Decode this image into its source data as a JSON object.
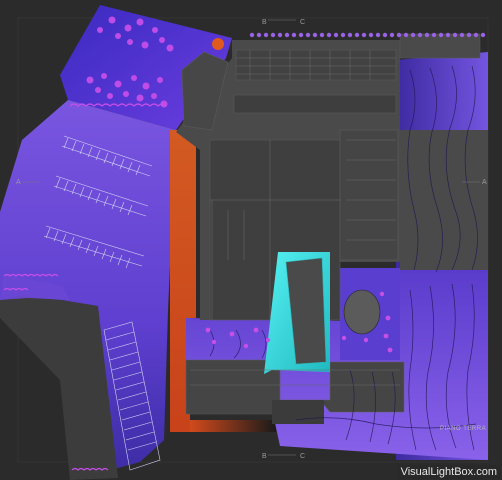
{
  "labels": {
    "section_a_left": "A",
    "section_a_right": "A",
    "section_b_top": "B",
    "section_c_top": "C",
    "section_b_bottom": "B",
    "section_c_bottom": "C"
  },
  "plan_title": "PIANO TERRA",
  "watermark": "VisualLightBox.com",
  "colors": {
    "background": "#2b2b2b",
    "violet": "#6e4bd6",
    "deep_blue": "#3a2aa8",
    "orange": "#d8521e",
    "cyan": "#3fe6e6",
    "magenta_dots": "#c64be8",
    "building_dark": "#474747"
  }
}
